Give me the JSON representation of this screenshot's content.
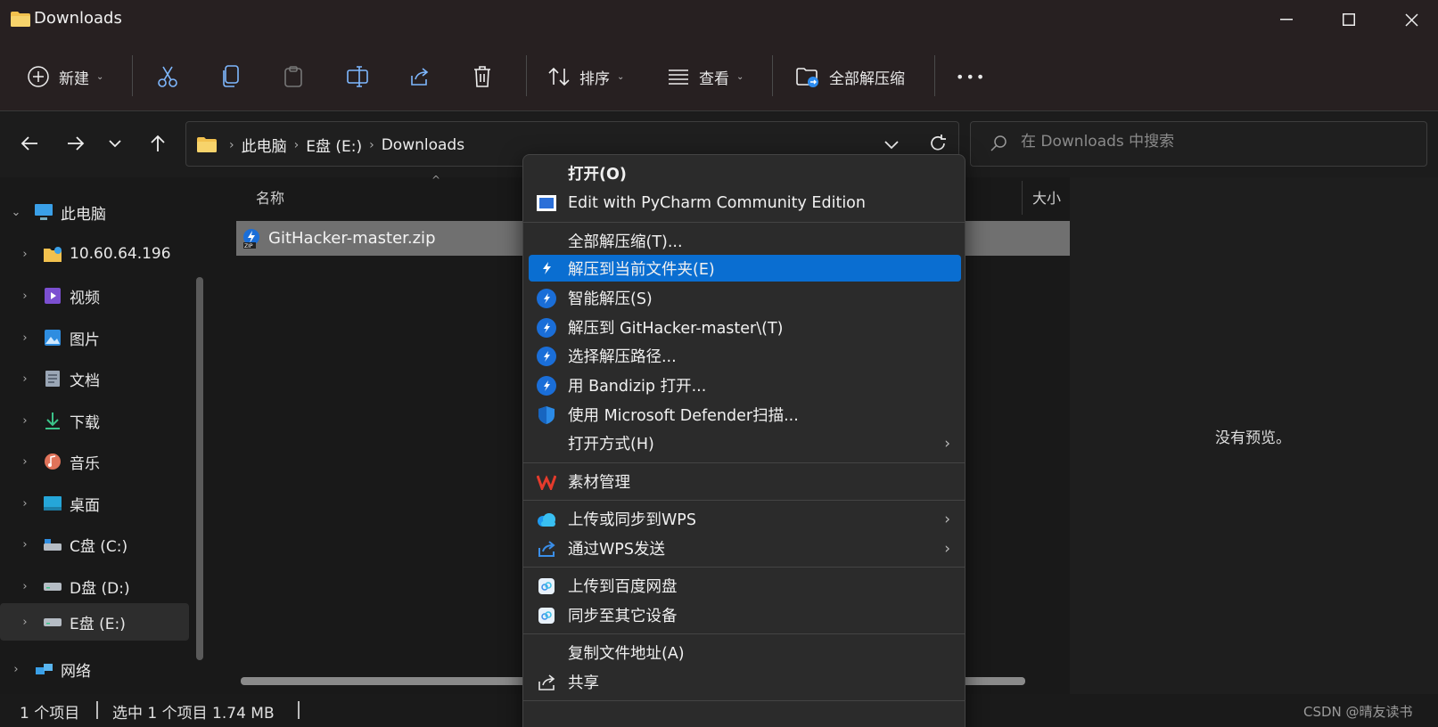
{
  "window": {
    "title": "Downloads"
  },
  "toolbar": {
    "new_label": "新建",
    "sort_label": "排序",
    "view_label": "查看",
    "extract_all_label": "全部解压缩",
    "more_label": "•••"
  },
  "address": {
    "crumbs": [
      "此电脑",
      "E盘 (E:)",
      "Downloads"
    ],
    "search_placeholder": "在 Downloads 中搜索"
  },
  "sidebar": {
    "items": [
      {
        "label": "此电脑",
        "icon": "computer-icon"
      },
      {
        "label": "10.60.64.196",
        "icon": "network-folder-icon"
      },
      {
        "label": "视频",
        "icon": "video-icon"
      },
      {
        "label": "图片",
        "icon": "picture-icon"
      },
      {
        "label": "文档",
        "icon": "document-icon"
      },
      {
        "label": "下载",
        "icon": "download-icon"
      },
      {
        "label": "音乐",
        "icon": "music-icon"
      },
      {
        "label": "桌面",
        "icon": "desktop-icon"
      },
      {
        "label": "C盘 (C:)",
        "icon": "drive-icon"
      },
      {
        "label": "D盘 (D:)",
        "icon": "drive-icon"
      },
      {
        "label": "E盘 (E:)",
        "icon": "drive-icon"
      },
      {
        "label": "网络",
        "icon": "network-icon"
      }
    ]
  },
  "content": {
    "col_name": "名称",
    "col_size": "大小",
    "file_name": "GitHacker-master.zip"
  },
  "preview": {
    "message": "没有预览。"
  },
  "status": {
    "count": "1 个项目",
    "selected": "选中 1 个项目  1.74 MB",
    "watermark": "CSDN @晴友读书"
  },
  "menu": {
    "items": [
      {
        "label": "打开(O)"
      },
      {
        "label": "Edit with PyCharm Community Edition"
      },
      {
        "label": "全部解压缩(T)..."
      },
      {
        "label": "解压到当前文件夹(E)"
      },
      {
        "label": "智能解压(S)"
      },
      {
        "label": "解压到 GitHacker-master\\(T)"
      },
      {
        "label": "选择解压路径..."
      },
      {
        "label": "用 Bandizip 打开..."
      },
      {
        "label": "使用 Microsoft Defender扫描..."
      },
      {
        "label": "打开方式(H)"
      },
      {
        "label": "素材管理"
      },
      {
        "label": "上传或同步到WPS"
      },
      {
        "label": "通过WPS发送"
      },
      {
        "label": "上传到百度网盘"
      },
      {
        "label": "同步至其它设备"
      },
      {
        "label": "复制文件地址(A)"
      },
      {
        "label": "共享"
      }
    ]
  },
  "colors": {
    "highlight": "#0a6ed1",
    "bandizip": "#1a6ed8",
    "wps_red": "#e53b2c"
  }
}
